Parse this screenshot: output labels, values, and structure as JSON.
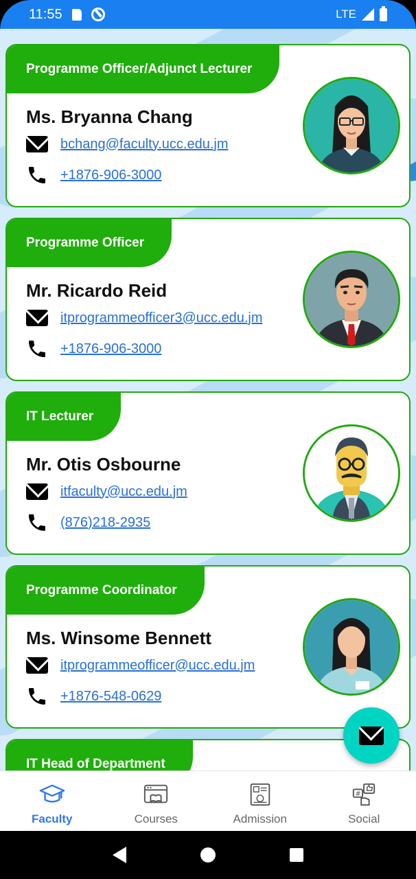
{
  "status_bar": {
    "time": "11:55",
    "network": "LTE"
  },
  "faculty": [
    {
      "role": "Programme Officer/Adjunct Lecturer",
      "name": "Ms. Bryanna Chang",
      "email": "bchang@faculty.ucc.edu.jm",
      "phone": "+1876-906-3000",
      "avatar": "female-glasses-avatar"
    },
    {
      "role": "Programme Officer",
      "name": "Mr. Ricardo Reid",
      "email": "itprogrammeofficer3@ucc.edu.jm",
      "phone": "+1876-906-3000",
      "avatar": "male-suit-avatar"
    },
    {
      "role": "IT Lecturer",
      "name": "Mr. Otis Osbourne",
      "email": "itfaculty@ucc.edu.jm",
      "phone": "(876)218-2935",
      "avatar": "male-glasses-avatar"
    },
    {
      "role": "Programme Coordinator",
      "name": "Ms. Winsome Bennett",
      "email": "itprogrammeofficer@ucc.edu.jm",
      "phone": "+1876-548-0629",
      "avatar": "female-badge-avatar"
    },
    {
      "role": "IT Head of Department",
      "name": "",
      "email": "",
      "phone": ""
    }
  ],
  "bottom_nav": [
    {
      "label": "Faculty",
      "icon": "graduation-cap-icon",
      "active": true
    },
    {
      "label": "Courses",
      "icon": "courses-icon",
      "active": false
    },
    {
      "label": "Admission",
      "icon": "admission-icon",
      "active": false
    },
    {
      "label": "Social",
      "icon": "social-icon",
      "active": false
    }
  ],
  "colors": {
    "status_bar": "#1a7ff0",
    "card_accent": "#1fae0b",
    "link": "#2870d4",
    "fab": "#00d4c2",
    "nav_active": "#2f7ae5"
  }
}
